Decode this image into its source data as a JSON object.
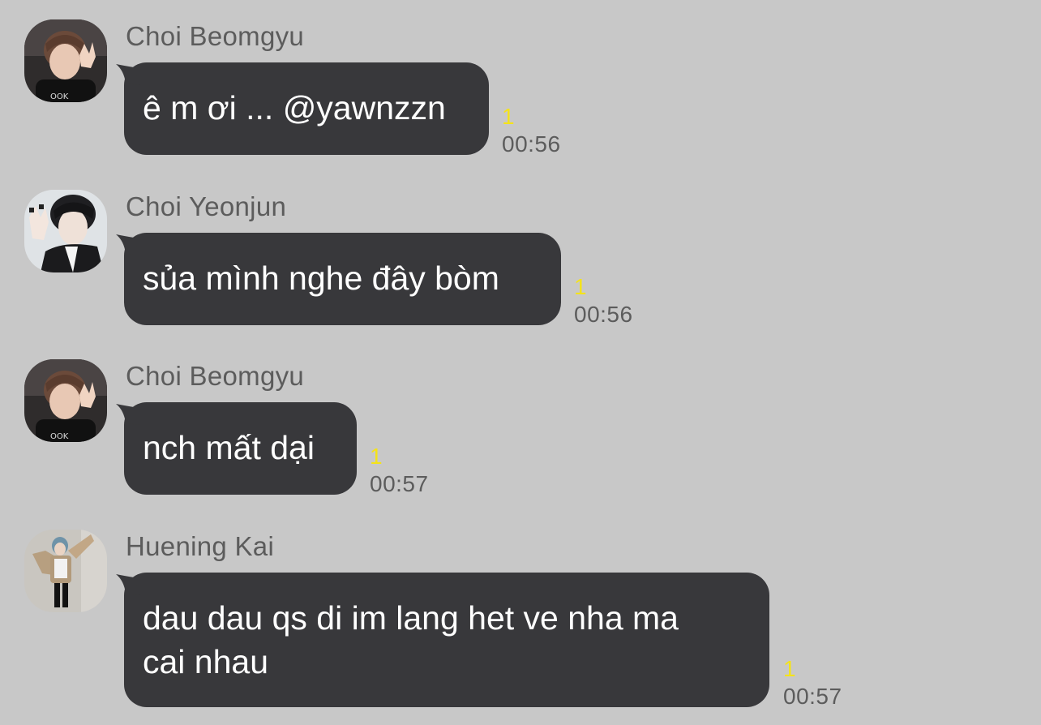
{
  "messages": [
    {
      "sender": "Choi Beomgyu",
      "avatar_icon": "avatar-choi-beomgyu-icon",
      "text": "ê m ơi ... @yawnzzn",
      "unread_count": "1",
      "time": "00:56"
    },
    {
      "sender": "Choi Yeonjun",
      "avatar_icon": "avatar-choi-yeonjun-icon",
      "text": "sủa mình nghe đây bòm",
      "unread_count": "1",
      "time": "00:56"
    },
    {
      "sender": "Choi Beomgyu",
      "avatar_icon": "avatar-choi-beomgyu-icon",
      "text": "nch mất dại",
      "unread_count": "1",
      "time": "00:57"
    },
    {
      "sender": "Huening Kai",
      "avatar_icon": "avatar-huening-kai-icon",
      "text": "dau dau qs di im lang het ve nha ma\ncai nhau",
      "unread_count": "1",
      "time": "00:57"
    }
  ],
  "colors": {
    "background": "#c8c8c8",
    "bubble": "#38383b",
    "bubble_text": "#ffffff",
    "sender_text": "#5c5c5c",
    "time_text": "#5c5c5c",
    "unread_text": "#f4e31a"
  }
}
